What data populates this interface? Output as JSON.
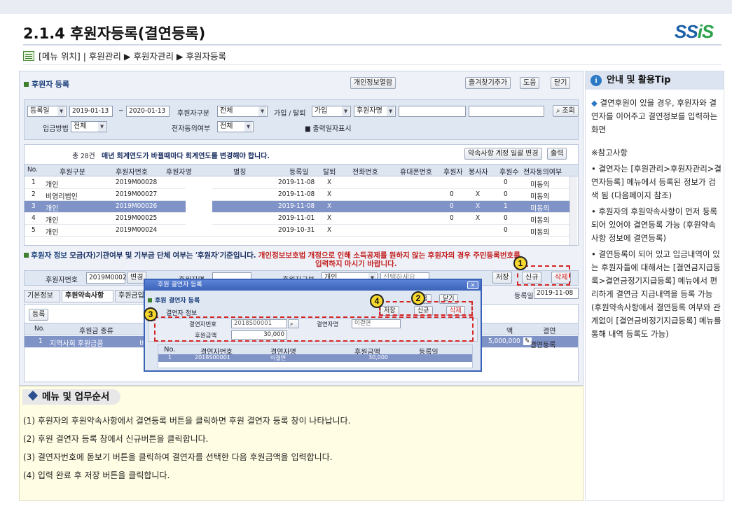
{
  "header": {
    "title": "2.1.4 후원자등록(결연등록)",
    "logo_a": "SS",
    "logo_b": "iS",
    "breadcrumb": "[메뉴 위치] | 후원관리 ▶ 후원자관리 ▶ 후원자등록"
  },
  "screen": {
    "section1": "후원자 등록",
    "top_buttons": {
      "privacy": "개인정보열람",
      "favorite": "즐겨찾기추가",
      "help": "도움",
      "close": "닫기"
    },
    "filter": {
      "date_select": "등록일",
      "date_from": "2019-01-13",
      "tilde": "~",
      "date_to": "2020-01-13",
      "donor_type_label": "후원자구분",
      "donor_type": "전체",
      "join_label": "가입 / 탈퇴",
      "join": "가입",
      "name_select": "후원자명",
      "search_button": "조회",
      "pay_method_label": "입금방법",
      "pay_method": "전체",
      "consent_label": "전자동의여부",
      "consent": "전체",
      "print_date_label": "출력일자표시"
    },
    "grid1": {
      "total": "총 28건",
      "notice": "매년 회계연도가 바뀔때마다 회계연도를 변경해야 합니다.",
      "batch_button": "약속사항 계정 일괄 변경",
      "print_button": "출력",
      "columns": [
        "No.",
        "후원구분",
        "후원자번호",
        "후원자명",
        "별칭",
        "등록일",
        "탈퇴",
        "전화번호",
        "휴대폰번호",
        "후원자",
        "봉사자",
        "후원수",
        "전자동의여부"
      ],
      "rows": [
        {
          "no": "1",
          "type": "개인",
          "id": "2019M00028",
          "date": "2019-11-08",
          "quit": "X",
          "donor": "",
          "vol": "",
          "count": "0",
          "consent": "미동의"
        },
        {
          "no": "2",
          "type": "비영리법인",
          "id": "2019M00027",
          "date": "2019-11-08",
          "quit": "X",
          "donor": "0",
          "vol": "X",
          "count": "0",
          "consent": "미동의"
        },
        {
          "no": "3",
          "type": "개인",
          "id": "2019M00026",
          "date": "2019-11-08",
          "quit": "X",
          "donor": "0",
          "vol": "X",
          "count": "1",
          "consent": "미동의"
        },
        {
          "no": "4",
          "type": "개인",
          "id": "2019M00025",
          "date": "2019-11-01",
          "quit": "X",
          "donor": "0",
          "vol": "X",
          "count": "0",
          "consent": "미동의"
        },
        {
          "no": "5",
          "type": "개인",
          "id": "2019M00024",
          "date": "2019-10-31",
          "quit": "X",
          "donor": "",
          "vol": "",
          "count": "0",
          "consent": "미동의"
        }
      ]
    },
    "section2": "후원자 정보",
    "section2_note": "모금(자)기관여부 및 기부금 단체 여부는 '후원자'기준입니다.",
    "section2_warn_1": "개인정보보호법 개정으로 인해 소득공제를 원하지 않는 후원자의 경우 주민등록번호를",
    "section2_warn_2": "입력하지 마시기 바랍니다.",
    "row2": {
      "donor_no_label": "후원자번호",
      "donor_no": "2019M00026",
      "change": "변경",
      "donor_name_label": "후원자명",
      "donor_type_label": "후원자구분",
      "donor_type": "개인",
      "select_placeholder": "선택하세요",
      "save": "저장",
      "new": "신규",
      "delete": "삭제",
      "reg_date_label": "등록일",
      "reg_date": "2019-11-08"
    },
    "tabs": [
      "기본정보",
      "후원약속사항",
      "후원금입금"
    ],
    "grid2": {
      "register_button": "등록",
      "col_no": "No.",
      "col_kind": "후원금 종류",
      "col_amount": "액",
      "col_link": "결연",
      "row_no": "1",
      "row_kind": "지역사회 후원금품",
      "row_kind2": "비",
      "row_amount": "5,000,000",
      "row_link": "결연등록"
    },
    "popup": {
      "title": "후원 결연자 등록",
      "section": "후원 결연자 등록",
      "subsection": "결연자 정보",
      "help": "도움",
      "close": "닫기",
      "save": "저장",
      "new": "신규",
      "delete": "삭제",
      "link_no_label": "결연자번호",
      "link_no": "2018S00001",
      "link_name_label": "결연자명",
      "link_name": "이결연",
      "amount_label": "후원금액",
      "amount": "30,000",
      "columns": [
        "No.",
        "결연자번호",
        "결연자명",
        "후원금액",
        "등록일"
      ],
      "row": {
        "no": "1",
        "id": "2018S00001",
        "name": "이결연",
        "amount": "30,000",
        "date": ""
      }
    }
  },
  "markers": [
    "1",
    "2",
    "3",
    "4"
  ],
  "tip": {
    "title": "안내 및 활용Tip",
    "intro": "결연후원이 있을 경우, 후원자와 결연자를 이어주고 결연정보를 입력하는 화면",
    "ref": "※참고사항",
    "items": [
      "결연자는 [후원관리>후원자관리>결연자등록] 메뉴에서 등록된 정보가 검색 됨 (다음페이지 참조)",
      "후원자의 후원약속사항이 먼저 등록되어 있어야 결연등록 가능 (후원약속사항 정보에 결연등록)",
      "결연등록이 되어 있고 입금내역이 있는 후원자들에 대해서는 [결연금지급등록>결연금정기지급등록] 메뉴에서 편리하게 결연금 지급내역을 등록 가능 (후원약속사항에서 결연등록 여부와 관계없이 [결연금비정기지급등록] 메뉴를 통해 내역 등록도 가능)"
    ]
  },
  "menu": {
    "title": "메뉴 및 업무순서",
    "steps": [
      "(1) 후원자의 후원약속사항에서 결연등록 버튼을 클릭하면 후원 결연자 등록 창이 나타납니다.",
      "(2) 후원 결연자 등록 창에서 신규버튼을 클릭합니다.",
      "(3) 결연자번호에 돋보기 버튼을 클릭하여 결연자를 선택한 다음 후원금액을 입력합니다.",
      "(4) 입력 완료 후 저장 버튼을 클릭합니다."
    ]
  }
}
